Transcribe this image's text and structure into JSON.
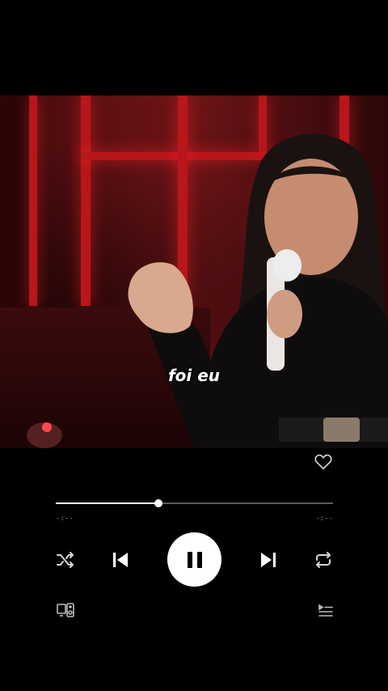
{
  "player": {
    "caption": "foi eu",
    "progress_fraction": 0.37,
    "elapsed_time": "-:--",
    "remaining_time": "-:--"
  },
  "icons": {
    "like": "heart-outline-icon",
    "shuffle": "shuffle-icon",
    "previous": "skip-previous-icon",
    "pause": "pause-icon",
    "next": "skip-next-icon",
    "repeat": "repeat-icon",
    "devices": "connect-devices-icon",
    "queue": "queue-icon"
  },
  "colors": {
    "accent": "#ffffff",
    "track": "#5a5a5a",
    "background": "#000000",
    "video_red": "#b8161b"
  }
}
